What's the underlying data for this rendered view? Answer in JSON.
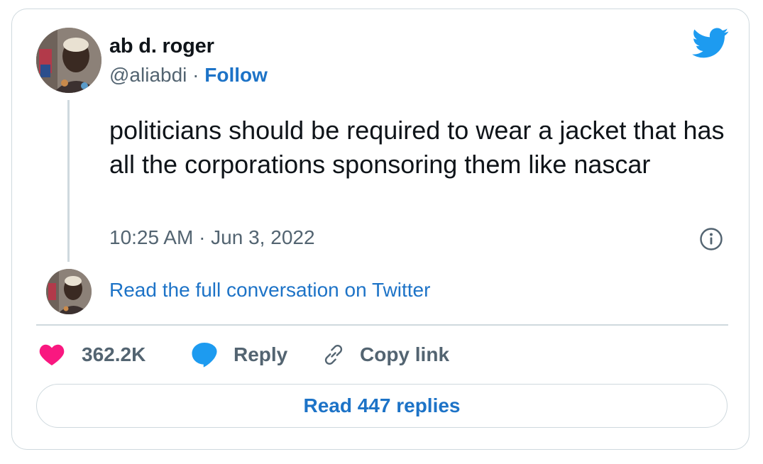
{
  "author": {
    "display_name": "ab d. roger",
    "handle": "@aliabdi",
    "separator": " · ",
    "follow_label": "Follow"
  },
  "tweet": {
    "text": "politicians should be required to wear a jacket that has all the corporations sponsoring them like nascar",
    "timestamp": "10:25 AM · Jun 3, 2022"
  },
  "conversation": {
    "link_label": "Read the full conversation on Twitter"
  },
  "actions": {
    "like_count": "362.2K",
    "reply_label": "Reply",
    "copy_link_label": "Copy link"
  },
  "footer": {
    "read_replies_label": "Read 447 replies"
  },
  "icons": {
    "brand": "twitter-bird-icon",
    "info": "info-icon",
    "like": "heart-icon",
    "reply": "speech-bubble-icon",
    "copy": "link-icon"
  },
  "colors": {
    "brand_blue": "#1d9bf0",
    "link_blue": "#1d73c7",
    "heart_pink": "#f91880",
    "secondary_text": "#536471",
    "border": "#cfd9de"
  }
}
